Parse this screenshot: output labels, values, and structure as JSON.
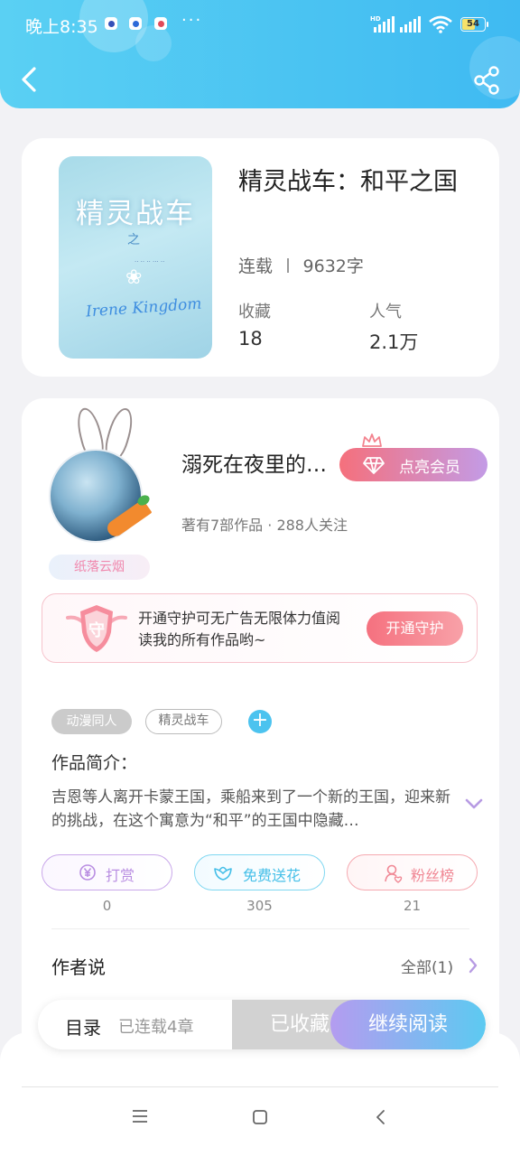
{
  "status_bar": {
    "time": "晚上8:35",
    "more": "···",
    "battery": "54"
  },
  "book": {
    "cover_title": "精灵战车",
    "cover_zhi": "之",
    "cover_subtitle": "Irene Kingdom",
    "title": "精灵战车：和平之国",
    "status": "连载",
    "word_count": "9632字",
    "favorites_label": "收藏",
    "favorites": "18",
    "popularity_label": "人气",
    "popularity": "2.1万"
  },
  "author": {
    "name": "溺死在夜里的…",
    "badge": "纸落云烟",
    "vip_button": "点亮会员",
    "stats": "著有7部作品 · 288人关注"
  },
  "guard": {
    "shield_text": "守",
    "text": "开通守护可无广告无限体力值阅读我的所有作品哟~",
    "button": "开通守护"
  },
  "tags": [
    "动漫同人",
    "精灵战车"
  ],
  "intro": {
    "title": "作品简介：",
    "text": "吉恩等人离开卡蒙王国，乘船来到了一个新的王国，迎来新的挑战，在这个寓意为“和平”的王国中隐藏…"
  },
  "actions": [
    {
      "label": "打赏",
      "count": "0"
    },
    {
      "label": "免费送花",
      "count": "305"
    },
    {
      "label": "粉丝榜",
      "count": "21"
    }
  ],
  "author_say": {
    "title": "作者说",
    "all": "全部(1)"
  },
  "bottom_bar": {
    "toc": "目录",
    "chapters": "已连载4章",
    "collected": "已收藏",
    "continue": "继续阅读"
  },
  "colors": {
    "accent_blue": "#4cc3ef",
    "vip_pink": "#f5707c",
    "header": "#4ec6f3"
  }
}
